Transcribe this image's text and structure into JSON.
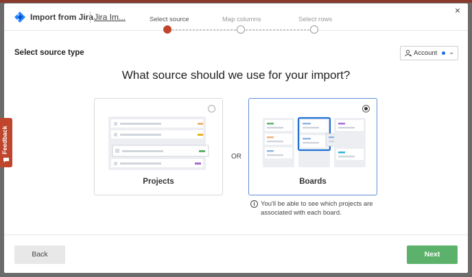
{
  "header": {
    "app_title": "Import from Jira",
    "project_link": "Jira Im...",
    "close_label": "×",
    "logo_icon": "jira-logo-icon"
  },
  "steps": [
    {
      "label": "Select source",
      "active": true
    },
    {
      "label": "Map columns",
      "active": false
    },
    {
      "label": "Select rows",
      "active": false
    }
  ],
  "section": {
    "label": "Select source type"
  },
  "account_button": {
    "label": "Account",
    "dot_color": "#1f6fd6",
    "chevron": "⌄"
  },
  "question": "What source should we use for your import?",
  "options": {
    "projects": {
      "label": "Projects",
      "selected": false
    },
    "or_label": "OR",
    "boards": {
      "label": "Boards",
      "selected": true
    }
  },
  "info": {
    "icon": "i",
    "text": "You'll be able to see which projects are associated with each board."
  },
  "footer": {
    "back_label": "Back",
    "next_label": "Next"
  },
  "feedback": {
    "label": "Feedback"
  },
  "colors": {
    "accent": "#c0452d",
    "primary_button": "#5cb26b",
    "selected_border": "#5b8ed6"
  }
}
